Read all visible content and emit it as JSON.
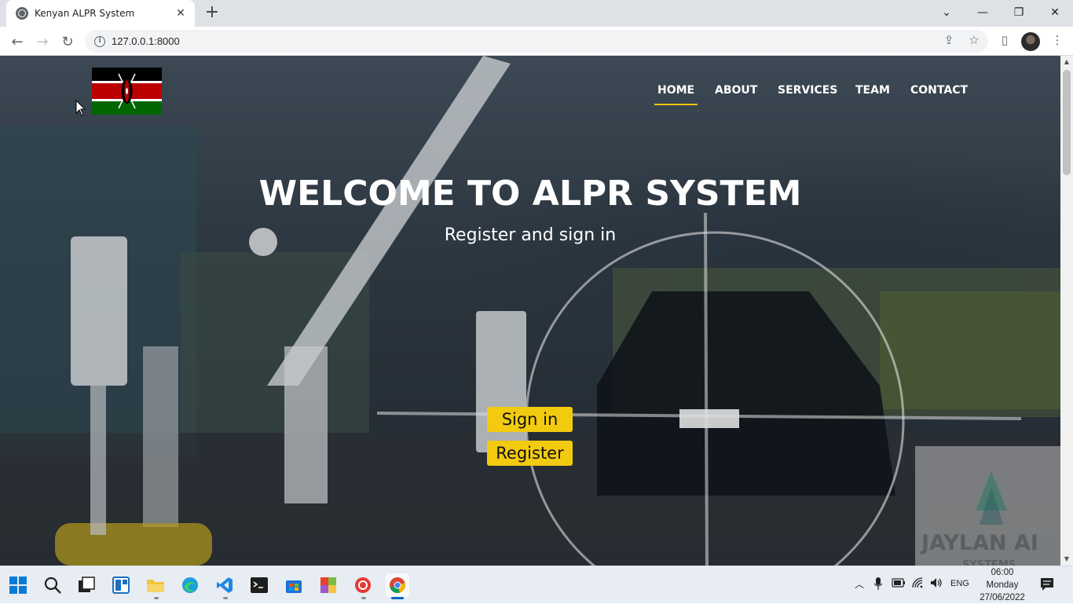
{
  "browser": {
    "tab_title": "Kenyan ALPR System",
    "url": "127.0.0.1:8000"
  },
  "site": {
    "nav": [
      {
        "label": "HOME",
        "active": true
      },
      {
        "label": "ABOUT",
        "active": false
      },
      {
        "label": "SERVICES",
        "active": false
      },
      {
        "label": "TEAM",
        "active": false
      },
      {
        "label": "CONTACT",
        "active": false
      }
    ],
    "hero_title": "WELCOME TO ALPR SYSTEM",
    "hero_subtitle": "Register and sign in",
    "signin_label": "Sign in",
    "register_label": "Register",
    "accent_color": "#f2ca0f",
    "watermark_text": "JAYLAN AI",
    "watermark_sub": "SYSTEMS"
  },
  "taskbar": {
    "apps": [
      "start-icon",
      "search-icon",
      "task-view-icon",
      "widgets-icon",
      "file-explorer-icon",
      "edge-icon",
      "vscode-icon",
      "terminal-icon",
      "store-icon",
      "office-icon",
      "recorder-icon",
      "chrome-icon"
    ],
    "language": "ENG",
    "time": "06:00",
    "day": "Monday",
    "date": "27/06/2022"
  }
}
